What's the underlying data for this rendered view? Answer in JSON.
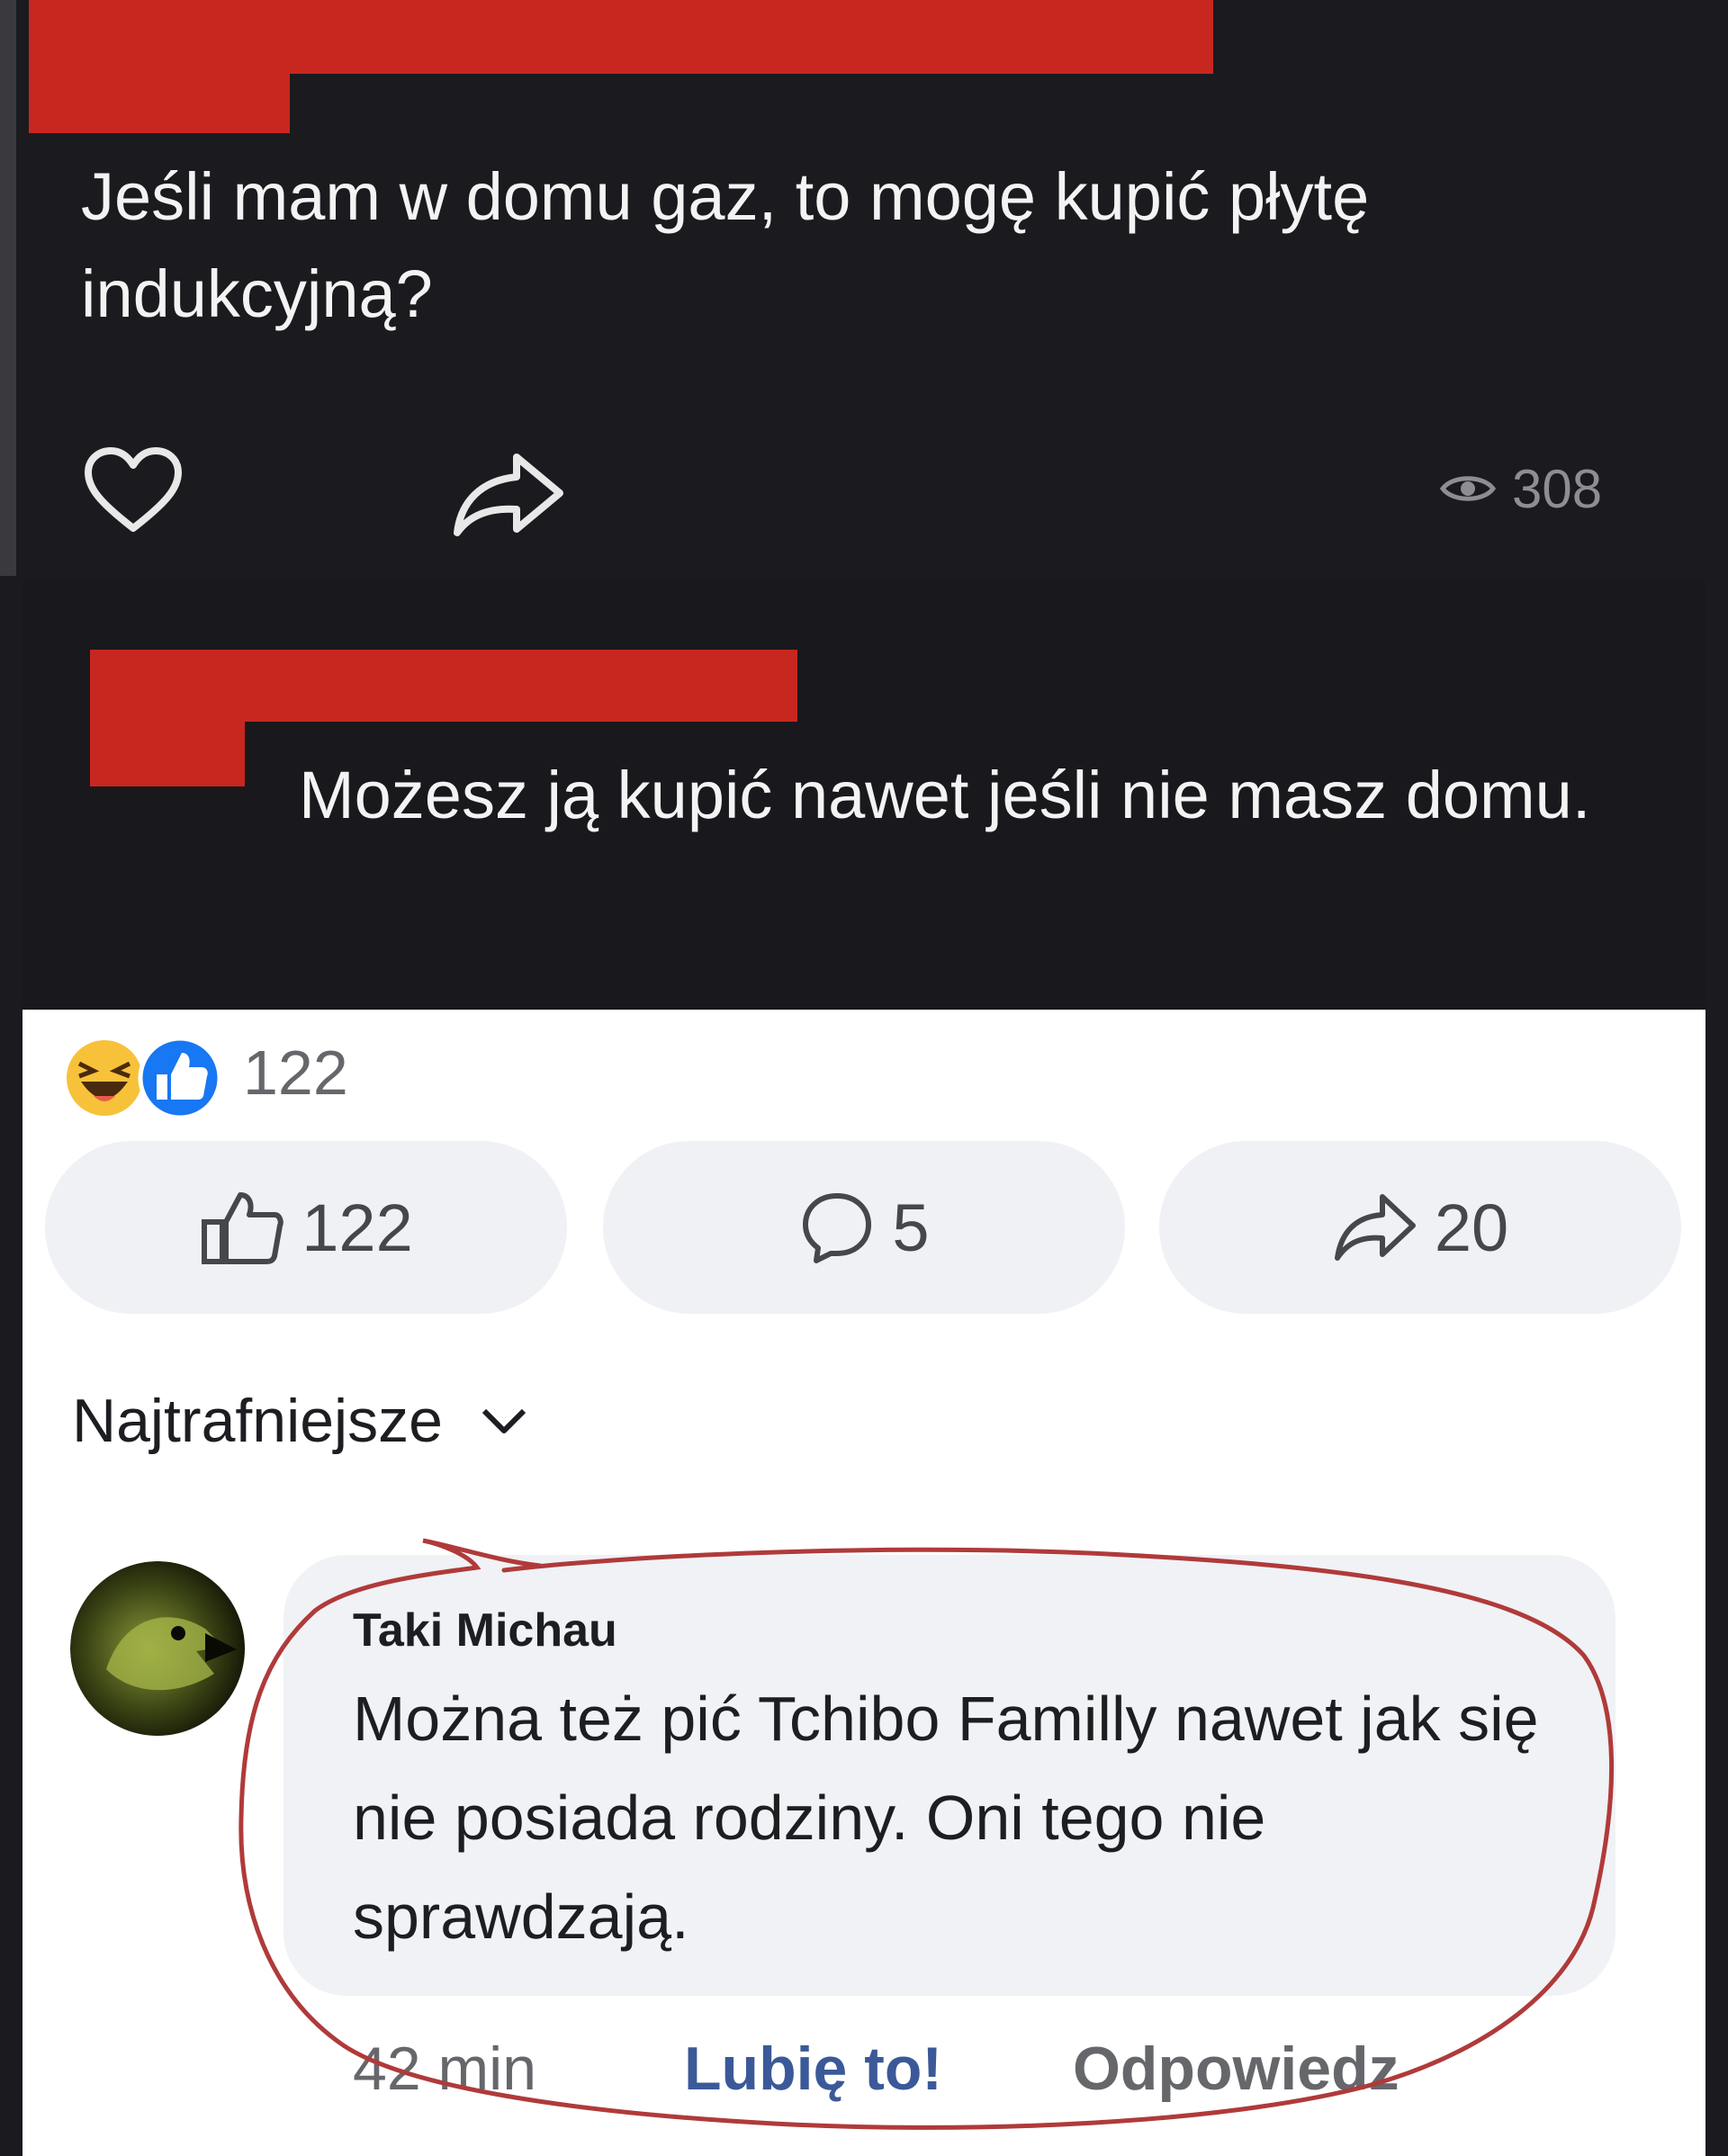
{
  "post": {
    "question": "Jeśli mam w domu gaz, to mogę kupić płytę indukcyjną?",
    "views": "308",
    "icons": [
      "heart-icon",
      "share-icon",
      "eye-icon"
    ]
  },
  "reply": {
    "text": "Możesz ją kupić nawet jeśli nie masz domu."
  },
  "reactions": {
    "count": "122",
    "icons": [
      "haha-reaction-icon",
      "like-reaction-icon"
    ]
  },
  "actions": {
    "like_count": "122",
    "comment_count": "5",
    "share_count": "20"
  },
  "sort": {
    "label": "Najtrafniejsze"
  },
  "comment": {
    "author": "Taki Michau",
    "text": "Można też pić Tchibo Familly nawet jak się nie posiada rodziny. Oni tego nie sprawdzają.",
    "time": "42 min",
    "like_label": "Lubię to!",
    "reply_label": "Odpowiedz"
  },
  "colors": {
    "dark_bg": "#1b1a1e",
    "redaction": "#c8271f",
    "link_blue": "#3b5998",
    "annotation": "#b03a3a"
  }
}
